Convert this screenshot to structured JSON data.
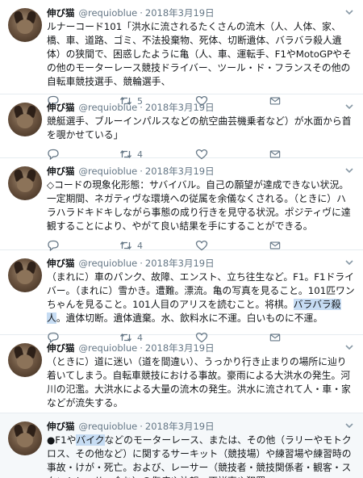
{
  "tweets": [
    {
      "name": "伸び猫",
      "handle": "@requioblue",
      "date": "2018年3月19日",
      "segments": [
        {
          "text": "ルナーコード101「洪水に流されるたくさんの流木（人、人体、家、橋、車、道路、ゴミ、不法投棄物、死体、切断遺体、バラバラ殺人遺体）の狭間で、困惑したように亀（人、車、運転手、F1やMotoGPやその他のモーターレース競技ドライバー、ツール・ド・フランスその他の自転車競技選手、競輪選手、"
        }
      ],
      "counts": {
        "reply": "",
        "retweet": "5",
        "like": ""
      }
    },
    {
      "name": "伸び猫",
      "handle": "@requioblue",
      "date": "2018年3月19日",
      "segments": [
        {
          "text": "競艇選手、ブルーインパルスなどの航空曲芸機乗者など）が水面から首を覗かせている」"
        }
      ],
      "counts": {
        "reply": "",
        "retweet": "4",
        "like": ""
      }
    },
    {
      "name": "伸び猫",
      "handle": "@requioblue",
      "date": "2018年3月19日",
      "segments": [
        {
          "text": "◇コードの現象化形態：サバイバル。自己の願望が達成できない状況。一定期間、ネガティヴな環境への従属を余儀なくされる。（ときに）ハラハラドキドキしながら事態の成り行きを見守る状況。ポジティヴに達観することにより、やがて良い結果を手にすることができる。"
        }
      ],
      "counts": {
        "reply": "",
        "retweet": "4",
        "like": ""
      }
    },
    {
      "name": "伸び猫",
      "handle": "@requioblue",
      "date": "2018年3月19日",
      "segments": [
        {
          "text": "（まれに）車のパンク、故障、エンスト、立ち往生など。F1。F1ドライバー。（まれに）雪かき。遭難。漂流。亀の写真を見ること。101匹ワンちゃんを見ること。101人目のアリスを読むこと。将棋。"
        },
        {
          "text": "バラバラ殺人",
          "highlight": true
        },
        {
          "text": "。遺体切断。遺体遺棄。水、飲料水に不運。白いものに不運。"
        }
      ],
      "counts": {
        "reply": "",
        "retweet": "4",
        "like": ""
      }
    },
    {
      "name": "伸び猫",
      "handle": "@requioblue",
      "date": "2018年3月19日",
      "segments": [
        {
          "text": "（ときに）道に迷い（道を間違い）、うっかり行き止まりの場所に辿り着いてしまう。自転車競技における事故。豪雨による大洪水の発生。河川の氾濫。大洪水による大量の流木の発生。洪水に流されて人・車・家などが流失する。"
        }
      ],
      "counts": {
        "reply": "",
        "retweet": "4",
        "like": ""
      }
    },
    {
      "name": "伸び猫",
      "handle": "@requioblue",
      "date": "2018年3月19日",
      "highlighted": true,
      "segments": [
        {
          "text": "●F1や"
        },
        {
          "text": "バイク",
          "highlight": true
        },
        {
          "text": "などのモーターレース、または、その他（ラリーやモトクロス、その他など）に関するサーキット（競技場）や練習場や練習時の事故・けが・死亡。および、レーサー（競技者・競技関係者・観客・スタントレーサー含む）の傷病や訃報、不祥事や犯罪。"
        }
      ],
      "counts": {
        "reply": "",
        "retweet": "",
        "like": ""
      }
    }
  ],
  "icons": {
    "caret": "chevron-down-icon",
    "reply": "reply-icon",
    "retweet": "retweet-icon",
    "like": "heart-icon",
    "dm": "envelope-icon"
  },
  "colors": {
    "highlight": "#c6dcf3",
    "muted": "#657786",
    "border": "#e6ecf0"
  }
}
